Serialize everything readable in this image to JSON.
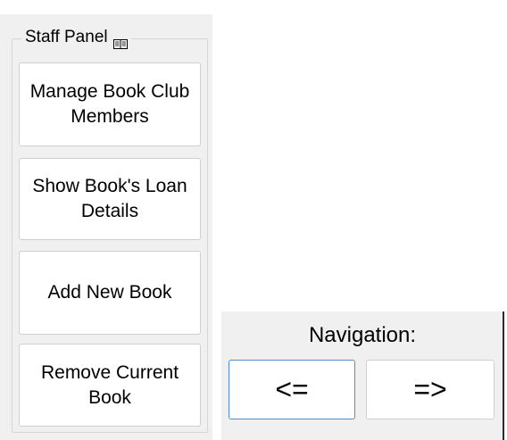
{
  "staff_panel": {
    "title": "Staff Panel",
    "title_icon": "book-icon",
    "buttons": [
      {
        "label": "Manage Book Club Members"
      },
      {
        "label": "Show Book's Loan Details"
      },
      {
        "label": "Add New Book"
      },
      {
        "label": "Remove Current Book"
      }
    ]
  },
  "navigation": {
    "label": "Navigation:",
    "prev_label": "<=",
    "next_label": "=>",
    "focus_color": "#4c8ed0"
  }
}
